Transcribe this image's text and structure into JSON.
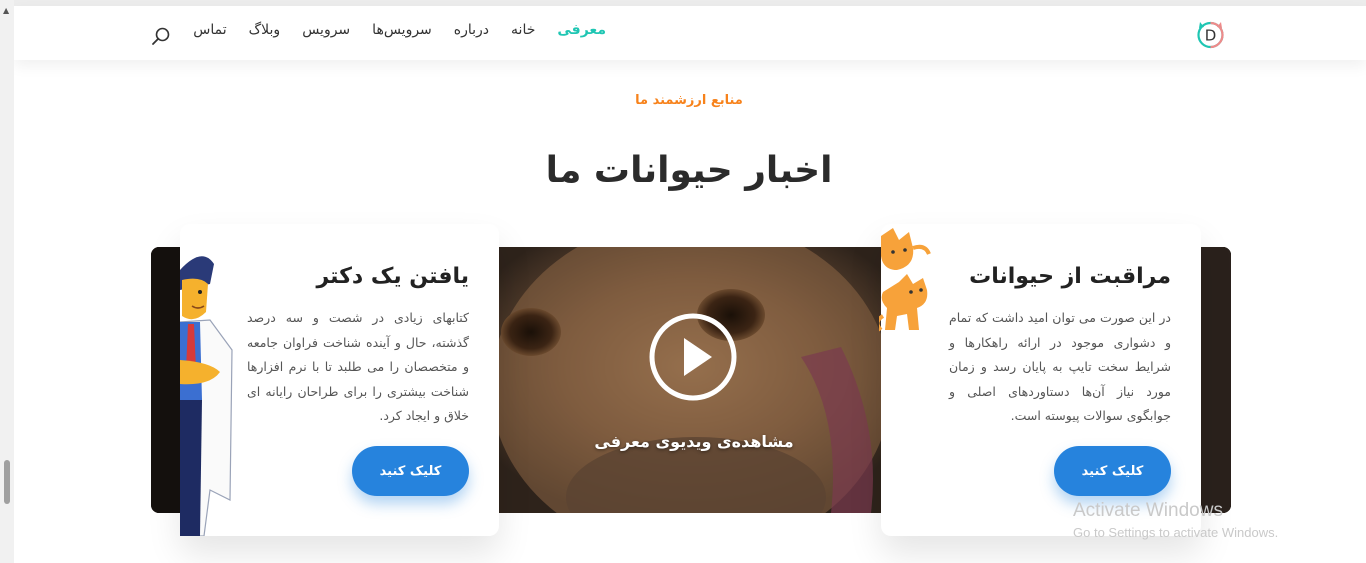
{
  "header": {
    "logo_letter": "D",
    "nav": [
      "معرفی",
      "خانه",
      "درباره",
      "سرویس‌ها",
      "سرویس",
      "وبلاگ",
      "تماس"
    ],
    "active_nav": "معرفی",
    "accent": "#1fc6b3"
  },
  "section": {
    "eyebrow": "منابع ارزشمند ما",
    "title": "اخبار حیوانات ما"
  },
  "cards": [
    {
      "title": "مراقبت از حیوانات",
      "text": "در این صورت می توان امید داشت که تمام و دشواری موجود در ارائه راهکارها و شرایط سخت تایپ به پایان رسد و زمان مورد نیاز آن‌ها دستاوردهای اصلی و جوابگوی سوالات پیوسته است.",
      "button": "کلیک کنید",
      "illustration": "cats-icon"
    },
    {
      "title": "یافتن یک دکتر",
      "text": "کتابهای زیادی در شصت و سه درصد گذشته، حال و آینده شناخت فراوان جامعه و متخصصان را می طلبد تا با نرم افزارها شناخت بیشتری را برای طراحان رایانه ای خلاق و ایجاد کرد.",
      "button": "کلیک کنید",
      "illustration": "doctor-icon"
    }
  ],
  "video": {
    "label": "مشاهده‌ی ویدیوی معرفی",
    "icon": "play-icon"
  },
  "colors": {
    "eyebrow": "#f7821b",
    "button": "#2683dd"
  },
  "watermark": {
    "line1": "Activate Windows",
    "line2": "Go to Settings to activate Windows."
  }
}
